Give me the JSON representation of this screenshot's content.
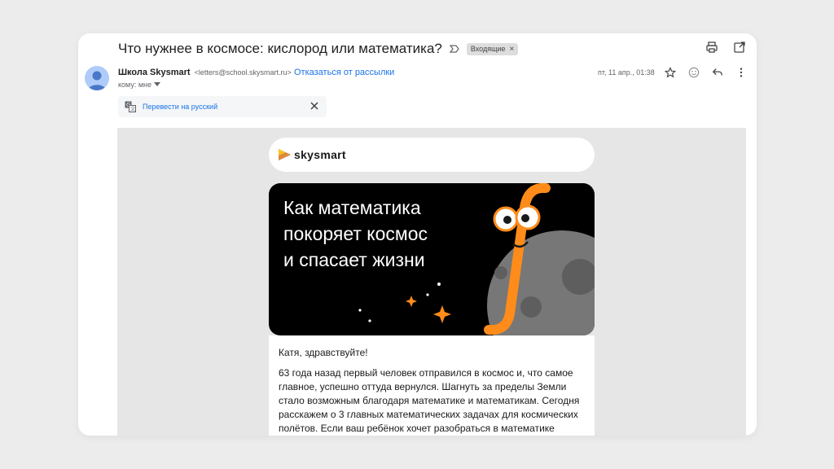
{
  "header": {
    "subject": "Что нужнее в космосе: кислород или математика?",
    "label": "Входящие",
    "label_close": "×"
  },
  "message": {
    "sender_name": "Школа Skysmart",
    "sender_email": "<letters@school.skysmart.ru>",
    "unsubscribe": "Отказаться от рассылки",
    "to": "кому: мне",
    "date": "пт, 11 апр., 01:38"
  },
  "translate": {
    "label": "Перевести на русский"
  },
  "email": {
    "logo": "skysmart",
    "hero_title_lines": [
      "Как математика",
      "покоряет космос",
      "и спасает жизни"
    ],
    "greeting": "Катя, здравствуйте!",
    "paragraph": "63 года назад первый человек отправился в космос и, что самое главное, успешно оттуда вернулся. Шагнуть за пределы Земли стало возможным благодаря математике и математикам. Сегодня расскажем о 3 главных математических задачах для космических полётов. Если ваш ребёнок хочет разобраться в математике"
  },
  "colors": {
    "link": "#1a73e8",
    "hero_bg": "#000000",
    "accent_orange": "#ff8c1a",
    "moon_gray": "#7a7a7a",
    "avatar_blue": "#aecbfa"
  },
  "icons": {
    "importance": "importance-marker-icon",
    "print": "print-icon",
    "open_new_window": "open-in-new-icon",
    "star": "star-icon",
    "emoji": "emoji-icon",
    "reply": "reply-icon",
    "more": "more-vertical-icon",
    "translate": "translate-icon",
    "close": "close-icon"
  }
}
